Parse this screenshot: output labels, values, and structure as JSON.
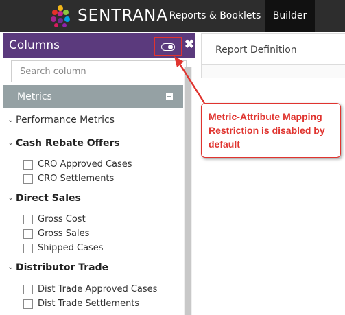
{
  "header": {
    "brand": "SENTRANA",
    "nav": [
      {
        "label": "Reports & Booklets",
        "active": false
      },
      {
        "label": "Builder",
        "active": true
      }
    ]
  },
  "columns_panel": {
    "title": "Columns",
    "toggle_state": "off",
    "search_placeholder": "Search column",
    "section": {
      "label": "Metrics",
      "groups_collapsed": [
        "Performance Metrics"
      ],
      "groups": [
        {
          "label": "Cash Rebate Offers",
          "items": [
            "CRO Approved Cases",
            "CRO Settlements"
          ]
        },
        {
          "label": "Direct Sales",
          "items": [
            "Gross Cost",
            "Gross Sales",
            "Shipped Cases"
          ]
        },
        {
          "label": "Distributor Trade",
          "items": [
            "Dist Trade Approved Cases",
            "Dist Trade Settlements"
          ]
        }
      ]
    }
  },
  "report_panel": {
    "title": "Report Definition"
  },
  "callout": {
    "text": "Metric-Attribute Mapping Restriction is disabled by default"
  },
  "colors": {
    "topbar": "#2d2d2d",
    "panel_header": "#5b3a7d",
    "metrics_bar": "#95a1a4",
    "annotation_red": "#e0342f"
  }
}
